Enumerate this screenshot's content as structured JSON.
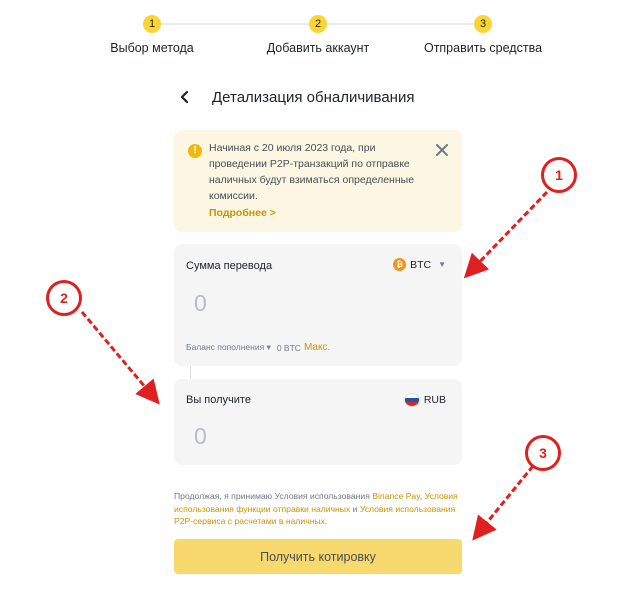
{
  "stepper": {
    "steps": [
      {
        "number": "1",
        "label": "Выбор метода"
      },
      {
        "number": "2",
        "label": "Добавить аккаунт"
      },
      {
        "number": "3",
        "label": "Отправить средства"
      }
    ]
  },
  "header": {
    "back_icon": "chevron-left-icon",
    "title": "Детализация обналичивания"
  },
  "notice": {
    "icon": "warning-icon",
    "text": "Начиная с 20 июля 2023 года, при проведении P2P-транзакций по отправке наличных будут взиматься определенные комиссии.",
    "link": "Подробнее >",
    "close_icon": "close-icon"
  },
  "send": {
    "label": "Сумма перевода",
    "amount": "0",
    "asset": "BTC",
    "balance_label": "Баланс пополнения",
    "balance_value": "0 BTC",
    "max_label": "Макс."
  },
  "receive": {
    "label": "Вы получите",
    "amount": "0",
    "currency": "RUB"
  },
  "terms": {
    "prefix": "Продолжая, я принимаю Условия использования ",
    "link1": "Binance Pay",
    "sep1": ", ",
    "link2": "Условия использования функции отправки наличных",
    "sep2": " и ",
    "link3": "Условия использования P2P-сервиса с расчетами в наличных",
    "suffix": "."
  },
  "quote_button": {
    "label": "Получить котировку"
  },
  "annotations": [
    "1",
    "2",
    "3"
  ],
  "colors": {
    "accent": "#fcd535",
    "link": "#c99400",
    "annotation": "#e02020",
    "notice_bg": "#fdf6e3",
    "button_bg": "#f8d96d"
  }
}
